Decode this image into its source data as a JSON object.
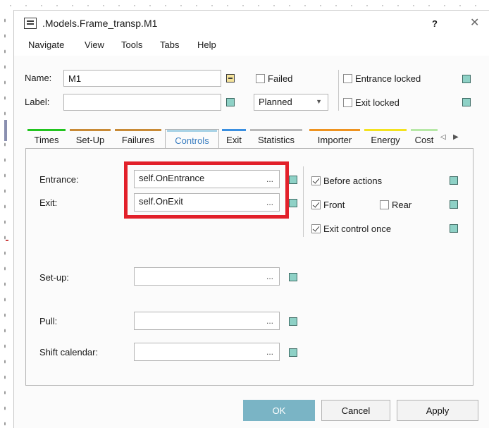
{
  "window": {
    "title": ".Models.Frame_transp.M1",
    "help": "?",
    "close": "✕"
  },
  "menu": [
    "Navigate",
    "View",
    "Tools",
    "Tabs",
    "Help"
  ],
  "header": {
    "name_label": "Name:",
    "name_value": "M1",
    "label_label": "Label:",
    "label_value": "",
    "failed": "Failed",
    "planned": "Planned",
    "entrance_locked": "Entrance locked",
    "exit_locked": "Exit locked"
  },
  "tabs": [
    {
      "label": "Times",
      "color": "#22c41f"
    },
    {
      "label": "Set-Up",
      "color": "#c88a36"
    },
    {
      "label": "Failures",
      "color": "#c88a36"
    },
    {
      "label": "Controls",
      "color": "#a9d3e6"
    },
    {
      "label": "Exit",
      "color": "#3b8fe0"
    },
    {
      "label": "Statistics",
      "color": "#b9b9b9"
    },
    {
      "label": "Importer",
      "color": "#ee9320"
    },
    {
      "label": "Energy",
      "color": "#f3e21e"
    },
    {
      "label": "Cost",
      "color": "#b6e8a6"
    }
  ],
  "controls": {
    "entrance_label": "Entrance:",
    "entrance_value": "self.OnEntrance",
    "exit_label": "Exit:",
    "exit_value": "self.OnExit",
    "setup_label": "Set-up:",
    "setup_value": "",
    "pull_label": "Pull:",
    "pull_value": "",
    "shift_label": "Shift calendar:",
    "shift_value": "",
    "ellipsis": "...",
    "before_actions": "Before actions",
    "front": "Front",
    "rear": "Rear",
    "exit_control_once": "Exit control once"
  },
  "buttons": {
    "ok": "OK",
    "cancel": "Cancel",
    "apply": "Apply"
  },
  "colors": {
    "highlight": "#e2202a",
    "ok_button": "#7ab4c5",
    "active_tab_text": "#3a7ec1",
    "inherit_square": "#8ed1c6"
  }
}
